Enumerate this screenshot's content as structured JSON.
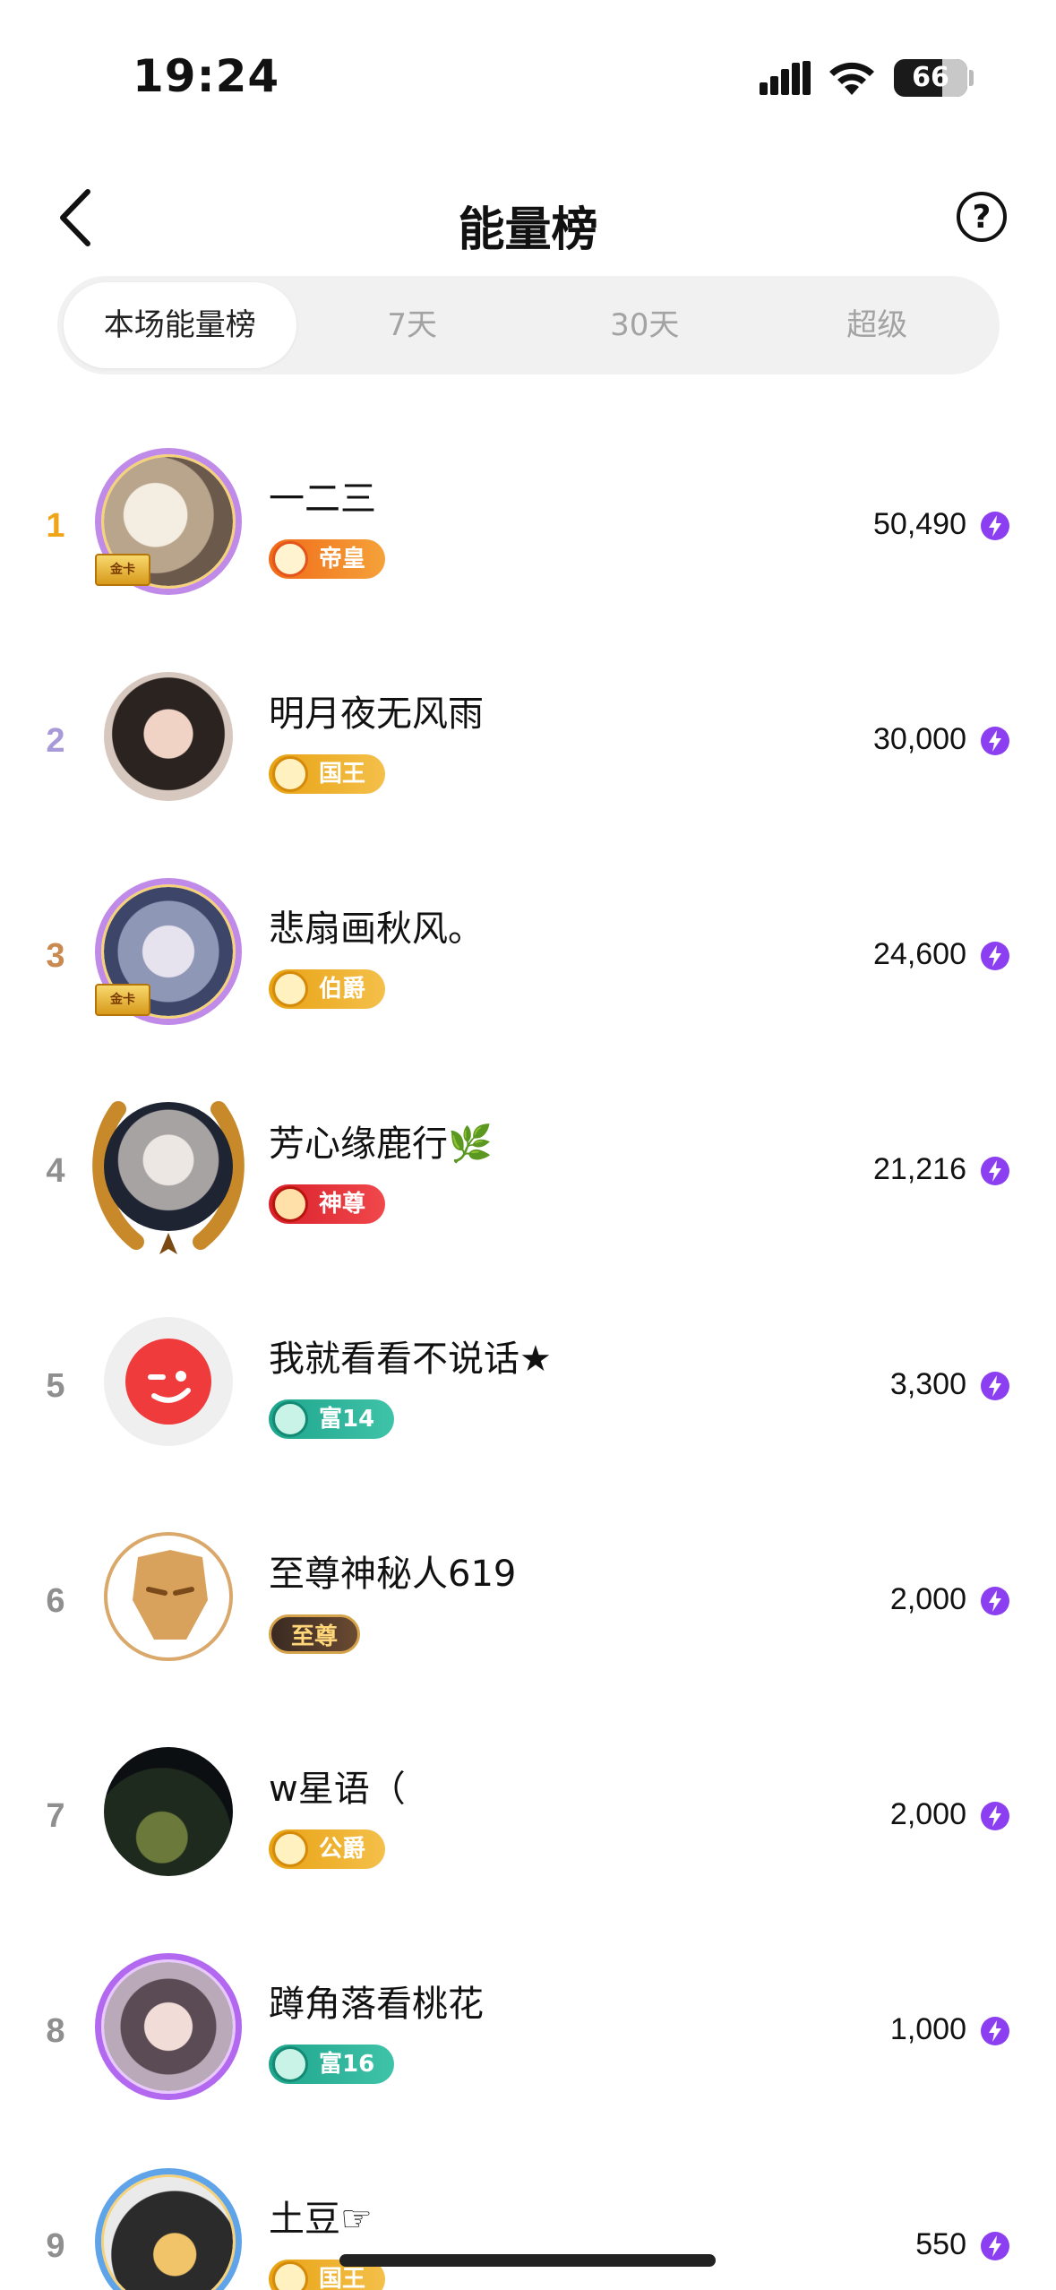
{
  "status_bar": {
    "time": "19:24",
    "battery": "66",
    "battery_level": 0.66
  },
  "nav": {
    "title": "能量榜",
    "help_label": "?"
  },
  "tabs": [
    {
      "label": "本场能量榜",
      "active": true
    },
    {
      "label": "7天",
      "active": false
    },
    {
      "label": "30天",
      "active": false
    },
    {
      "label": "超级",
      "active": false
    }
  ],
  "colors": {
    "energy_icon": "#8b3ff0",
    "rank1": "#f0a417",
    "rank2": "#a89ad8",
    "rank3": "#c98a52",
    "rank_other": "#8f8f8f"
  },
  "rows": [
    {
      "rank": "1",
      "name": "一二三",
      "badge": "帝皇",
      "badge_style": "orange",
      "score": "50,490",
      "gold_card": "金卡"
    },
    {
      "rank": "2",
      "name": "明月夜无风雨",
      "badge": "国王",
      "badge_style": "gold",
      "score": "30,000"
    },
    {
      "rank": "3",
      "name": "悲扇画秋风。",
      "badge": "伯爵",
      "badge_style": "gold",
      "score": "24,600",
      "gold_card": "金卡"
    },
    {
      "rank": "4",
      "name": "芳心缘鹿行🌿",
      "badge": "神尊",
      "badge_style": "red",
      "score": "21,216"
    },
    {
      "rank": "5",
      "name": "我就看看不说话★",
      "badge": "富14",
      "badge_style": "teal",
      "score": "3,300"
    },
    {
      "rank": "6",
      "name": "至尊神秘人619",
      "badge": "至尊",
      "badge_style": "dark",
      "score": "2,000"
    },
    {
      "rank": "7",
      "name": "w星语（",
      "badge": "公爵",
      "badge_style": "gold",
      "score": "2,000"
    },
    {
      "rank": "8",
      "name": "蹲角落看桃花",
      "badge": "富16",
      "badge_style": "teal",
      "score": "1,000"
    },
    {
      "rank": "9",
      "name": "土豆☞",
      "badge": "国王",
      "badge_style": "gold",
      "score": "550"
    }
  ]
}
